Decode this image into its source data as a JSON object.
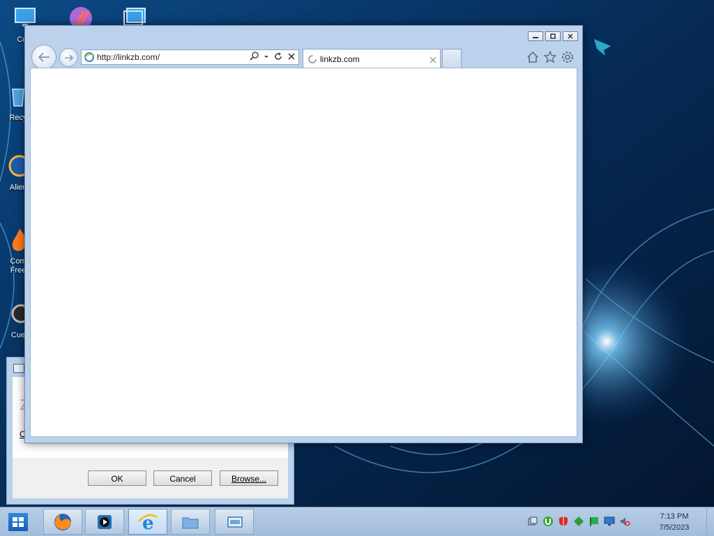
{
  "desktop": {
    "icons": [
      {
        "label": "Com",
        "icon": "computer-icon"
      },
      {
        "label": "",
        "icon": "paint-app-icon"
      },
      {
        "label": "",
        "icon": "computer-shortcut-icon"
      },
      {
        "label": "Recy",
        "icon": "recycle-bin-icon"
      },
      {
        "label": "Alien",
        "icon": "alien-browser-icon"
      },
      {
        "label": "Com",
        "label2": "Free",
        "icon": "fire-app-icon"
      },
      {
        "label": "Cue",
        "icon": "cue-app-icon"
      }
    ]
  },
  "ie": {
    "address": "http://linkzb.com/",
    "tab_title": "linkzb.com",
    "buttons": {
      "minimize": "minimize",
      "maximize": "maximize",
      "close": "close"
    }
  },
  "run_dialog": {
    "open_label": "O",
    "glyph": "Z",
    "ok_label": "OK",
    "cancel_label": "Cancel",
    "browse_label": "Browse..."
  },
  "taskbar": {
    "time": "7:13 PM",
    "date": "7/5/2023",
    "apps": [
      "firefox-icon",
      "media-player-icon",
      "internet-explorer-icon",
      "file-explorer-icon",
      "window-app-icon"
    ],
    "tray": [
      "window-switch-icon",
      "utorrent-icon",
      "shield-icon",
      "network-green-icon",
      "flag-icon",
      "monitor-icon",
      "volume-muted-icon"
    ]
  },
  "colors": {
    "accent": "#1e6fc8",
    "taskbar": "#b0c8e4",
    "window_frame": "#bcd2ec"
  }
}
